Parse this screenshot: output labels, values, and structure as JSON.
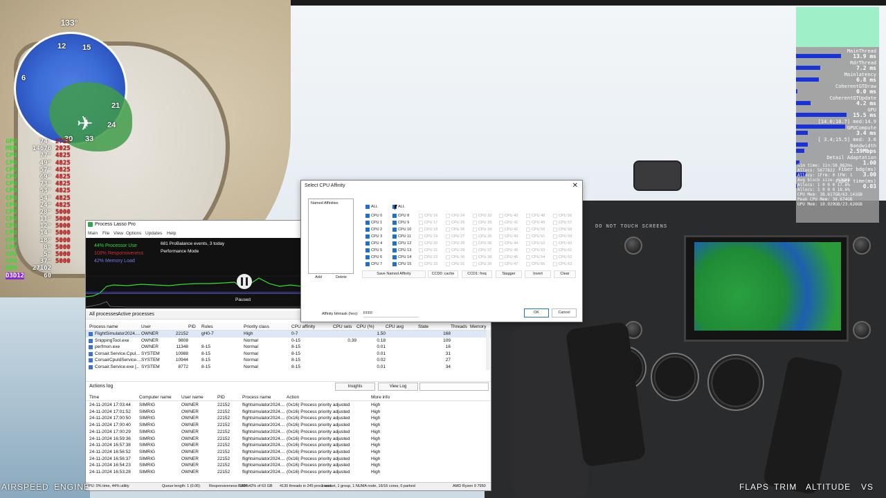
{
  "hud": {
    "heading": "133°",
    "compass_labels": [
      "12",
      "15",
      "6",
      "21",
      "24",
      "30",
      "33"
    ],
    "bottom_labels": [
      "AIRSPEED",
      "ENGINE",
      "FLAPS",
      "TRIM",
      "ALTITUDE",
      "VS"
    ]
  },
  "cpu_overlay": {
    "rows": [
      {
        "name": "GPU",
        "value": "74°",
        "freq": "2725"
      },
      {
        "name": "MEM",
        "value": "14676",
        "freq": "2025"
      },
      {
        "name": "CPU",
        "value": "77°",
        "freq": "4825"
      },
      {
        "name": "CPU",
        "value": "49°",
        "freq": "4825"
      },
      {
        "name": "CPU",
        "value": "57°",
        "freq": "4825"
      },
      {
        "name": "CPU",
        "value": "69°",
        "freq": "4825"
      },
      {
        "name": "CPU",
        "value": "73°",
        "freq": "4825"
      },
      {
        "name": "CPU",
        "value": "53°",
        "freq": "4825"
      },
      {
        "name": "CPU",
        "value": "54°",
        "freq": "4825"
      },
      {
        "name": "CPU",
        "value": "24°",
        "freq": "4825"
      },
      {
        "name": "CPU",
        "value": "28°",
        "freq": "5000"
      },
      {
        "name": "CPU",
        "value": "11°",
        "freq": "5000"
      },
      {
        "name": "CPU",
        "value": "12°",
        "freq": "5000"
      },
      {
        "name": "CPU",
        "value": "14°",
        "freq": "5000"
      },
      {
        "name": "CPU",
        "value": "18°",
        "freq": "5000"
      },
      {
        "name": "CPU",
        "value": "8°",
        "freq": "5000"
      },
      {
        "name": "CPU",
        "value": "5°",
        "freq": "5000"
      },
      {
        "name": "CPU",
        "value": "37°",
        "freq": "5000"
      },
      {
        "name": "RAM",
        "value": "27102",
        "freq": ""
      },
      {
        "name": "D3D12",
        "value": "60",
        "freq": ""
      }
    ]
  },
  "perf_overlay": {
    "metrics": [
      {
        "label": "MainThread",
        "value": "13.9 ms",
        "bar": 0.55
      },
      {
        "label": "RdrThread",
        "value": "7.2 ms",
        "bar": 0.3
      },
      {
        "label": "Mainlatency",
        "value": "6.8 ms",
        "bar": 0.28
      },
      {
        "label": "CoherentGTDraw",
        "value": "0.0 ms",
        "bar": 0.02
      },
      {
        "label": "CoherentGTUpdate",
        "value": "4.2 ms",
        "bar": 0.18
      },
      {
        "label": "GPU",
        "value": "15.5 ms",
        "bar": 0.62
      },
      {
        "label": "[14.0;16.7] med:14.9",
        "value": "",
        "bar": 0.6
      },
      {
        "label": "GPUCompute",
        "value": "3.4 ms",
        "bar": 0.14
      },
      {
        "label": "[ 3.4;15.5] med: 3.6",
        "value": "",
        "bar": 0.14
      },
      {
        "label": "Bandwidth",
        "value": "2.59Mbps",
        "bar": 0.1
      },
      {
        "label": "Detail Adaptation",
        "value": "1.00",
        "bar": 0.04
      },
      {
        "label": "Fiber bdg(ms)",
        "value": "3.00",
        "bar": 0.12
      },
      {
        "label": "Fiber time(ms)",
        "value": "0.03",
        "bar": 0.01
      }
    ],
    "footer": [
      "Sim time: 1in:58.862ms",
      "Allocs: 5677822",
      "Allocs: 1Frm: 0 1FW: 1",
      "Avg block size: 52908",
      "Allocs: 1 0 0 0 17.6%",
      "Allocs: 1 0 0 0 18.6%",
      "CPU Mem: 38.617GB/63.141GB",
      "Peak CPU Mem: 38.674GB",
      "GPU Mem: 10.929GB/23.626GB"
    ]
  },
  "process_lasso": {
    "title": "Process Lasso Pro",
    "menu": [
      "Main",
      "File",
      "View",
      "Options",
      "Updates",
      "Help"
    ],
    "graph": {
      "processor_use": "44% Processor Use",
      "responsiveness": "100% Responsiveness",
      "memory_load": "42% Memory Load",
      "probalance": "681 ProBalance events, 3 today",
      "mode": "Performance Mode",
      "paused": "Paused"
    },
    "tabs": [
      "All processes",
      "Active processes"
    ],
    "columns": [
      "Process name",
      "User",
      "PID",
      "Rules",
      "Priority class",
      "CPU affinity",
      "CPU sets",
      "CPU (%)",
      "CPU avg",
      "State",
      "Threads",
      "Memory"
    ],
    "rows": [
      [
        "FlightSimulator2024....",
        "OWNER",
        "22152",
        "gH0-7",
        "High",
        "0-7",
        "",
        "",
        "1.50",
        "",
        "168"
      ],
      [
        "SnippingTool.exe",
        "OWNER",
        "9808",
        "",
        "Normal",
        "0-15",
        "",
        "0.39",
        "0.18",
        "",
        "109"
      ],
      [
        "perfmon.exe",
        "OWNER",
        "11348",
        "8-15",
        "Normal",
        "8-15",
        "",
        "",
        "0.01",
        "",
        "16"
      ],
      [
        "Corsair.Service.CpuI...",
        "SYSTEM",
        "10988",
        "8-15",
        "Normal",
        "8-15",
        "",
        "",
        "0.01",
        "",
        "31"
      ],
      [
        "CorsairCpuIdService....",
        "SYSTEM",
        "10944",
        "8-15",
        "Normal",
        "8-15",
        "",
        "",
        "0.02",
        "",
        "27"
      ],
      [
        "Corsair.Service.exe [..",
        "SYSTEM",
        "8772",
        "8-15",
        "Normal",
        "8-15",
        "",
        "",
        "0.01",
        "",
        "34"
      ]
    ],
    "actions_log": "Actions log",
    "insights": "Insights",
    "view_log": "View Log",
    "log_columns": [
      "Time",
      "Computer name",
      "User name",
      "PID",
      "Process name",
      "Action",
      "More info"
    ],
    "log_rows": [
      [
        "24-11-2024 17:03:44",
        "SIMRIG",
        "OWNER",
        "22152",
        "flightsimulator2024....",
        "(0x16) Process priority adjusted",
        "High"
      ],
      [
        "24-11-2024 17:01:52",
        "SIMRIG",
        "OWNER",
        "22152",
        "flightsimulator2024....",
        "(0x16) Process priority adjusted",
        "High"
      ],
      [
        "24-11-2024 17:00:50",
        "SIMRIG",
        "OWNER",
        "22152",
        "flightsimulator2024....",
        "(0x16) Process priority adjusted",
        "High"
      ],
      [
        "24-11-2024 17:00:40",
        "SIMRIG",
        "OWNER",
        "22152",
        "flightsimulator2024....",
        "(0x16) Process priority adjusted",
        "High"
      ],
      [
        "24-11-2024 17:00:29",
        "SIMRIG",
        "OWNER",
        "22152",
        "flightsimulator2024....",
        "(0x16) Process priority adjusted",
        "High"
      ],
      [
        "24-11-2024 16:59:36",
        "SIMRIG",
        "OWNER",
        "22152",
        "flightsimulator2024....",
        "(0x16) Process priority adjusted",
        "High"
      ],
      [
        "24-11-2024 16:57:38",
        "SIMRIG",
        "OWNER",
        "22152",
        "flightsimulator2024....",
        "(0x16) Process priority adjusted",
        "High"
      ],
      [
        "24-11-2024 16:56:52",
        "SIMRIG",
        "OWNER",
        "22152",
        "flightsimulator2024....",
        "(0x16) Process priority adjusted",
        "High"
      ],
      [
        "24-11-2024 16:56:37",
        "SIMRIG",
        "OWNER",
        "22152",
        "flightsimulator2024....",
        "(0x16) Process priority adjusted",
        "High"
      ],
      [
        "24-11-2024 16:54:23",
        "SIMRIG",
        "OWNER",
        "22152",
        "flightsimulator2024....",
        "(0x16) Process priority adjusted",
        "High"
      ],
      [
        "24-11-2024 16:53:28",
        "SIMRIG",
        "OWNER",
        "22152",
        "flightsimulator2024....",
        "(0x16) Process priority adjusted",
        "High"
      ]
    ],
    "status": [
      "CPU: 0% time, 44% utility",
      "Queue length: 1 (0.06)",
      "Responsiveness: 100%",
      "RAM: 42% of 63 GB",
      "4130 threads in 245 processes",
      "1 socket, 1 group, 1 NUMA node, 16/16 cores, 0 parked",
      "AMD Ryzen 9 7950"
    ]
  },
  "affinity_dialog": {
    "title": "Select CPU Affinity",
    "close": "✕",
    "named_affinities": "Named Affinities",
    "add": "Add",
    "delete": "Delete",
    "all_label": "ALL",
    "cpu_columns": [
      [
        "CPU 0",
        "CPU 1",
        "CPU 2",
        "CPU 3",
        "CPU 4",
        "CPU 5",
        "CPU 6",
        "CPU 7"
      ],
      [
        "CPU 8",
        "CPU 9",
        "CPU 10",
        "CPU 11",
        "CPU 12",
        "CPU 13",
        "CPU 14",
        "CPU 15"
      ],
      [
        "CPU 16",
        "CPU 17",
        "CPU 18",
        "CPU 19",
        "CPU 20",
        "CPU 21",
        "CPU 22",
        "CPU 23"
      ],
      [
        "CPU 24",
        "CPU 25",
        "CPU 26",
        "CPU 27",
        "CPU 28",
        "CPU 29",
        "CPU 30",
        "CPU 31"
      ],
      [
        "CPU 32",
        "CPU 33",
        "CPU 34",
        "CPU 35",
        "CPU 36",
        "CPU 37",
        "CPU 38",
        "CPU 39"
      ],
      [
        "CPU 40",
        "CPU 41",
        "CPU 42",
        "CPU 43",
        "CPU 44",
        "CPU 45",
        "CPU 46",
        "CPU 47"
      ],
      [
        "CPU 48",
        "CPU 49",
        "CPU 50",
        "CPU 51",
        "CPU 52",
        "CPU 53",
        "CPU 54",
        "CPU 55"
      ],
      [
        "CPU 56",
        "CPU 57",
        "CPU 58",
        "CPU 59",
        "CPU 60",
        "CPU 61",
        "CPU 62",
        "CPU 63"
      ]
    ],
    "buttons": [
      "Save Named Affinity",
      "CCD0: cache",
      "CCD1: freq",
      "Stagger",
      "Invert",
      "Clear"
    ],
    "bitmask_label": "Affinity bitmask (hex):",
    "bitmask_value": "FFFF",
    "ok": "OK",
    "cancel": "Cancel"
  },
  "cockpit": {
    "placard": "DO NOT TOUCH SCREENS"
  }
}
